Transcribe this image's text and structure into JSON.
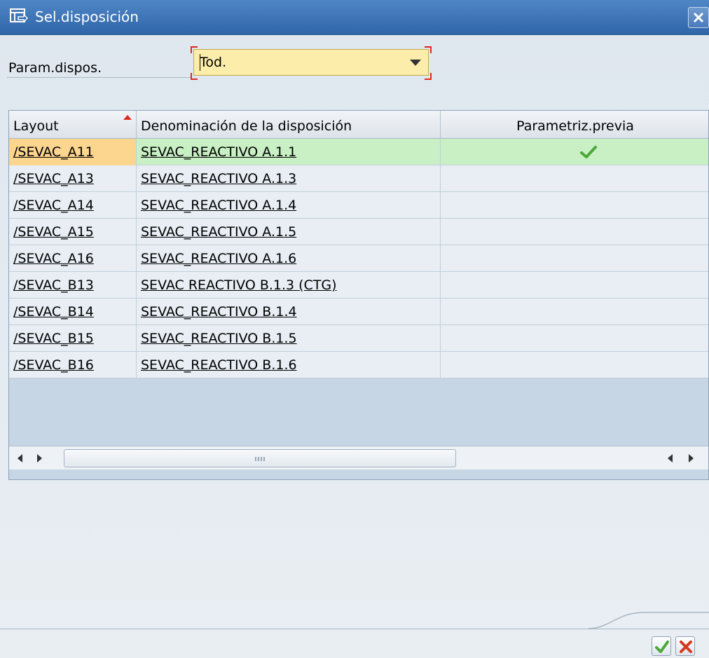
{
  "window": {
    "title": "Sel.disposición",
    "icons": {
      "title": "layout-select-icon",
      "close": "close-icon"
    }
  },
  "filter": {
    "label": "Param.dispos.",
    "value": "Tod.",
    "icon": "chevron-down-icon"
  },
  "table": {
    "columns": [
      "Layout",
      "Denominación de la disposición",
      "Parametriz.previa"
    ],
    "sort_column": "Layout",
    "rows": [
      {
        "layout": "/SEVAC_A11",
        "name": "SEVAC_REACTIVO A.1.1",
        "default": true
      },
      {
        "layout": "/SEVAC_A13",
        "name": "SEVAC_REACTIVO A.1.3",
        "default": false
      },
      {
        "layout": "/SEVAC_A14",
        "name": "SEVAC_REACTIVO A.1.4",
        "default": false
      },
      {
        "layout": "/SEVAC_A15",
        "name": "SEVAC_REACTIVO A.1.5",
        "default": false
      },
      {
        "layout": "/SEVAC_A16",
        "name": "SEVAC_REACTIVO A.1.6",
        "default": false
      },
      {
        "layout": "/SEVAC_B13",
        "name": "SEVAC REACTIVO B.1.3 (CTG)",
        "default": false
      },
      {
        "layout": "/SEVAC_B14",
        "name": "SEVAC_REACTIVO B.1.4",
        "default": false
      },
      {
        "layout": "/SEVAC_B15",
        "name": "SEVAC_REACTIVO B.1.5",
        "default": false
      },
      {
        "layout": "/SEVAC_B16",
        "name": "SEVAC_REACTIVO B.1.6",
        "default": false
      }
    ]
  },
  "footer": {
    "confirm_icon": "checkmark-icon",
    "cancel_icon": "cancel-x-icon"
  },
  "colors": {
    "titlebar": "#3b73b6",
    "selected_row": "#c8f0c4",
    "selected_cell": "#fcd58e",
    "dropdown_bg": "#fcedaa",
    "focus_marker": "#e0281f",
    "check_green": "#4da83a",
    "cancel_red": "#d23a1e"
  }
}
